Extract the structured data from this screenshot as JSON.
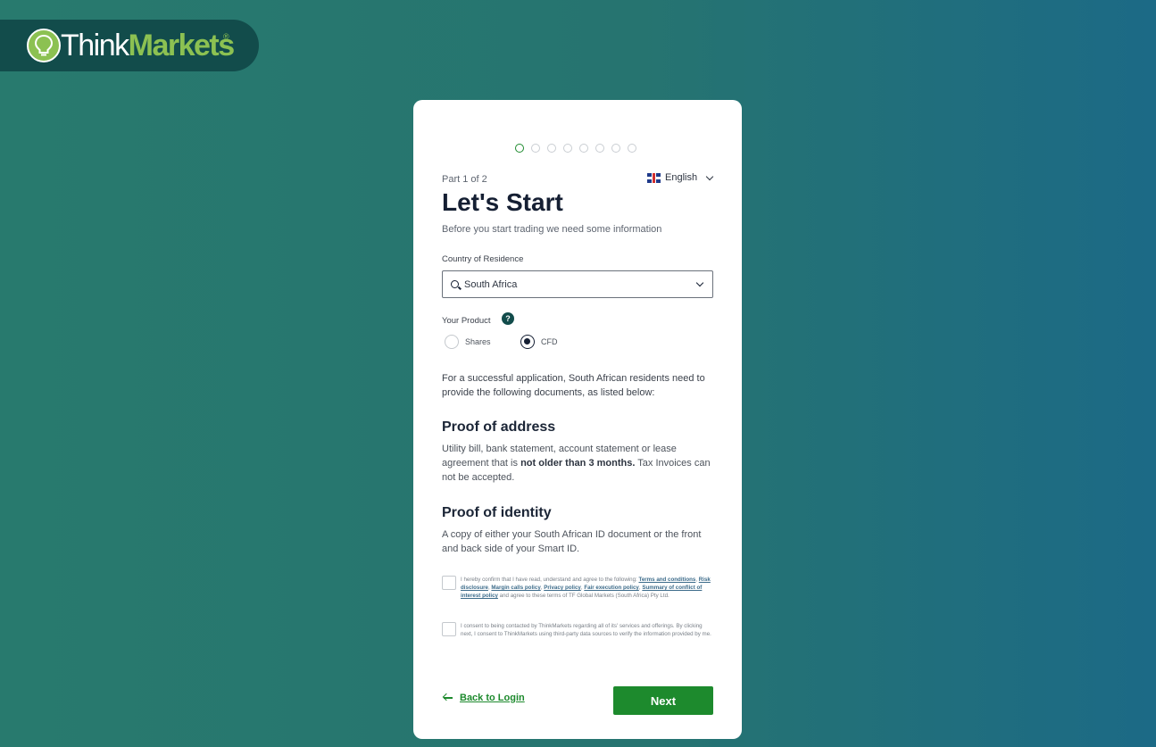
{
  "brand": {
    "name_part1": "Think",
    "name_part2": "Markets",
    "reg_mark": "®"
  },
  "progress": {
    "total_steps": 8,
    "current_step": 1
  },
  "header": {
    "part_text": "Part 1 of 2",
    "language": "English",
    "title": "Let's Start",
    "subtitle": "Before you start trading we need some information"
  },
  "country": {
    "label": "Country of Residence",
    "value": "South Africa"
  },
  "product": {
    "label": "Your Product",
    "help_symbol": "?",
    "options": [
      {
        "label": "Shares",
        "selected": false
      },
      {
        "label": "CFD",
        "selected": true
      }
    ]
  },
  "intro": "For a successful application, South African residents need to provide the following documents, as listed below:",
  "proof_address": {
    "heading": "Proof of address",
    "text_before": "Utility bill, bank statement, account statement or lease agreement that is ",
    "bold": "not older than 3 months.",
    "text_after": " Tax Invoices can not be accepted."
  },
  "proof_identity": {
    "heading": "Proof of identity",
    "text": "A copy of either your South African ID document or the front and back side of your Smart ID."
  },
  "consent1": {
    "prefix": "I hereby confirm that I have read, understand and agree to the following: ",
    "link1": "Terms and conditions",
    "link2": "Risk disclosure",
    "link3": "Margin calls policy",
    "link4": "Privacy policy",
    "link5": "Fair execution policy",
    "link6": "Summary of conflict of interest policy",
    "suffix": " and agree to these terms of TF Global Markets (South Africa) Pty Ltd."
  },
  "consent2": {
    "text": "I consent to being contacted by ThinkMarkets regarding all of its' services and offerings. By clicking next, I consent to ThinkMarkets using third-party data sources to verify the information provided by me."
  },
  "footer": {
    "back_label": "Back to Login",
    "next_label": "Next"
  }
}
